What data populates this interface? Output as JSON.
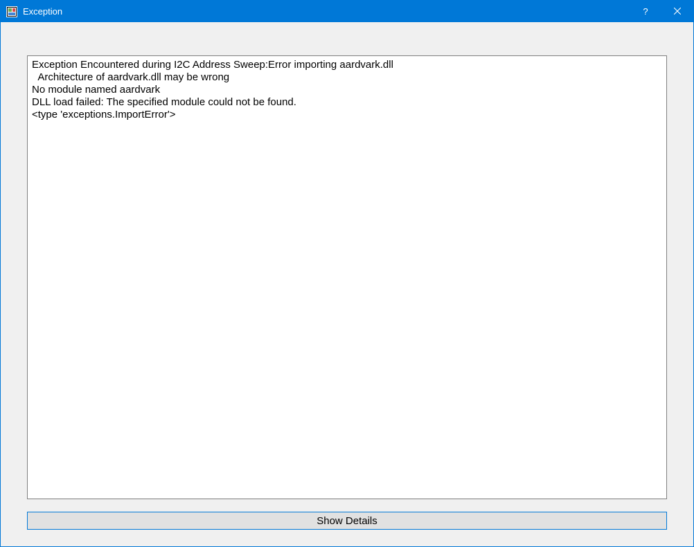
{
  "titlebar": {
    "title": "Exception",
    "help_label": "?",
    "close_label": "✕"
  },
  "main": {
    "error_text": "Exception Encountered during I2C Address Sweep:Error importing aardvark.dll\n  Architecture of aardvark.dll may be wrong\nNo module named aardvark\nDLL load failed: The specified module could not be found.\n<type 'exceptions.ImportError'>"
  },
  "footer": {
    "show_details_label": "Show Details"
  }
}
